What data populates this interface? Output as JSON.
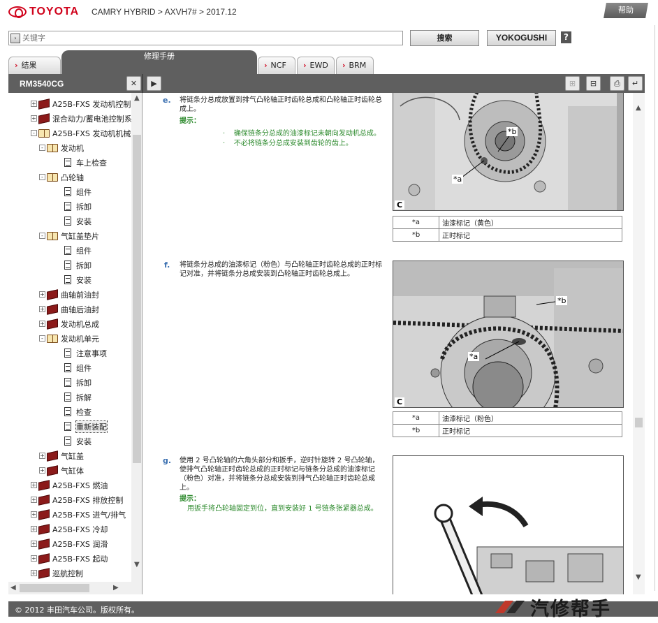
{
  "header": {
    "brand": "TOYOTA",
    "breadcrumb": "CAMRY HYBRID > AXVH7# > 2017.12",
    "help_label": "帮助"
  },
  "search": {
    "placeholder": "关键字",
    "search_button": "搜索",
    "yokogushi_button": "YOKOGUSHI",
    "help_icon": "?"
  },
  "tabs": [
    {
      "label": "结果",
      "arrow": true
    },
    {
      "label": "修理手册",
      "active": true
    },
    {
      "label": "NCF",
      "arrow": true
    },
    {
      "label": "EWD",
      "arrow": true
    },
    {
      "label": "BRM",
      "arrow": true
    }
  ],
  "toolbar": {
    "doc_id": "RM3540CG",
    "icons": [
      "close-icon",
      "expand-right-icon",
      "zoom-in-icon",
      "zoom-out-icon",
      "print-icon",
      "back-icon"
    ]
  },
  "tree": {
    "items": [
      {
        "label": "A25B-FXS 发动机控制",
        "type": "book-closed",
        "level": 0,
        "pm": "+"
      },
      {
        "label": "混合动力/蓄电池控制系",
        "type": "book-closed",
        "level": 0,
        "pm": "+"
      },
      {
        "label": "A25B-FXS 发动机机械",
        "type": "book-open",
        "level": 0,
        "pm": "-"
      },
      {
        "label": "发动机",
        "type": "book-open",
        "level": 1,
        "pm": "-"
      },
      {
        "label": "车上检查",
        "type": "doc",
        "level": 2
      },
      {
        "label": "凸轮轴",
        "type": "book-open",
        "level": 1,
        "pm": "-"
      },
      {
        "label": "组件",
        "type": "doc",
        "level": 2
      },
      {
        "label": "拆卸",
        "type": "doc",
        "level": 2
      },
      {
        "label": "安装",
        "type": "doc",
        "level": 2
      },
      {
        "label": "气缸盖垫片",
        "type": "book-open",
        "level": 1,
        "pm": "-"
      },
      {
        "label": "组件",
        "type": "doc",
        "level": 2
      },
      {
        "label": "拆卸",
        "type": "doc",
        "level": 2
      },
      {
        "label": "安装",
        "type": "doc",
        "level": 2
      },
      {
        "label": "曲轴前油封",
        "type": "book-closed",
        "level": 1,
        "pm": "+"
      },
      {
        "label": "曲轴后油封",
        "type": "book-closed",
        "level": 1,
        "pm": "+"
      },
      {
        "label": "发动机总成",
        "type": "book-closed",
        "level": 1,
        "pm": "+"
      },
      {
        "label": "发动机单元",
        "type": "book-open",
        "level": 1,
        "pm": "-"
      },
      {
        "label": "注意事项",
        "type": "doc",
        "level": 2
      },
      {
        "label": "组件",
        "type": "doc",
        "level": 2
      },
      {
        "label": "拆卸",
        "type": "doc",
        "level": 2
      },
      {
        "label": "拆解",
        "type": "doc",
        "level": 2
      },
      {
        "label": "检查",
        "type": "doc",
        "level": 2
      },
      {
        "label": "重新装配",
        "type": "doc",
        "level": 2,
        "selected": true
      },
      {
        "label": "安装",
        "type": "doc",
        "level": 2
      },
      {
        "label": "气缸盖",
        "type": "book-closed",
        "level": 1,
        "pm": "+"
      },
      {
        "label": "气缸体",
        "type": "book-closed",
        "level": 1,
        "pm": "+"
      },
      {
        "label": "A25B-FXS 燃油",
        "type": "book-closed",
        "level": 0,
        "pm": "+"
      },
      {
        "label": "A25B-FXS 排放控制",
        "type": "book-closed",
        "level": 0,
        "pm": "+"
      },
      {
        "label": "A25B-FXS 进气/排气",
        "type": "book-closed",
        "level": 0,
        "pm": "+"
      },
      {
        "label": "A25B-FXS 冷却",
        "type": "book-closed",
        "level": 0,
        "pm": "+"
      },
      {
        "label": "A25B-FXS 润滑",
        "type": "book-closed",
        "level": 0,
        "pm": "+"
      },
      {
        "label": "A25B-FXS 起动",
        "type": "book-closed",
        "level": 0,
        "pm": "+"
      },
      {
        "label": "巡航控制",
        "type": "book-closed",
        "level": 0,
        "pm": "+"
      }
    ]
  },
  "steps": {
    "e": {
      "letter": "e.",
      "text": "将链条分总成放置到排气凸轮轴正时齿轮总成和凸轮轴正时齿轮总成上。",
      "hint_label": "提示：",
      "hints": [
        "确保链条分总成的油漆标记未朝向发动机总成。",
        "不必将链条分总成安装到齿轮的齿上。"
      ],
      "figure_label": "C",
      "callouts": [
        "*a",
        "*b"
      ],
      "legend": [
        {
          "key": "*a",
          "value": "油漆标记（黄色）"
        },
        {
          "key": "*b",
          "value": "正时标记"
        }
      ]
    },
    "f": {
      "letter": "f.",
      "text": "将链条分总成的油漆标记（粉色）与凸轮轴正时齿轮总成的正时标记对准，并将链条分总成安装到凸轮轴正时齿轮总成上。",
      "figure_label": "C",
      "callouts": [
        "*a",
        "*b"
      ],
      "legend": [
        {
          "key": "*a",
          "value": "油漆标记（粉色）"
        },
        {
          "key": "*b",
          "value": "正时标记"
        }
      ]
    },
    "g": {
      "letter": "g.",
      "text": "使用 2 号凸轮轴的六角头部分和扳手，逆时针旋转 2 号凸轮轴，使排气凸轮轴正时齿轮总成的正时标记与链条分总成的油漆标记（粉色）对准，并将链条分总成安装到排气凸轮轴正时齿轮总成上。",
      "hint_label": "提示：",
      "hints": [
        "用扳手将凸轮轴固定到位，直到安装好 1 号链条张紧器总成。"
      ]
    }
  },
  "footer": {
    "copyright": "© 2012 丰田汽车公司。版权所有。"
  },
  "watermark": {
    "text": "汽修帮手"
  },
  "colors": {
    "brand_red": "#d0021b",
    "panel_gray": "#5f5f5f",
    "hint_green": "#2e8b2e",
    "step_letter_blue": "#3a6fb0"
  }
}
